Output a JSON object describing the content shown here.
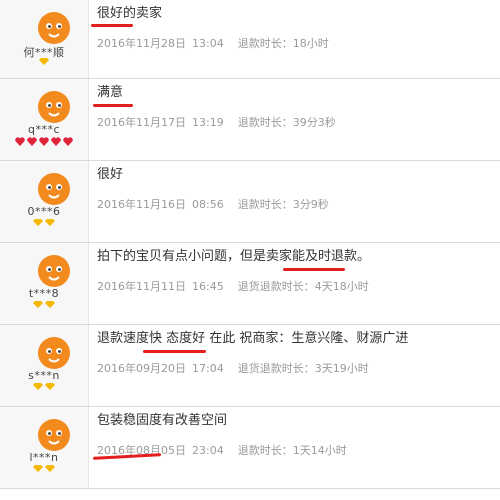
{
  "reviews": [
    {
      "comment": "很好的卖家",
      "date": "2016年11月28日",
      "time": "13:04",
      "refund_label": "退款时长：",
      "duration": "18小时",
      "user": "何***顺",
      "badge_type": "yellow-diamond",
      "badge_count": 1
    },
    {
      "comment": "满意",
      "date": "2016年11月17日",
      "time": "13:19",
      "refund_label": "退款时长：",
      "duration": "39分3秒",
      "user": "q***c",
      "badge_type": "red-heart",
      "badge_count": 5
    },
    {
      "comment": "很好",
      "date": "2016年11月16日",
      "time": "08:56",
      "refund_label": "退款时长：",
      "duration": "3分9秒",
      "user": "0***6",
      "badge_type": "yellow-diamond",
      "badge_count": 2
    },
    {
      "comment": "拍下的宝贝有点小问题，但是卖家能及时退款。",
      "date": "2016年11月11日",
      "time": "16:45",
      "refund_label": "退货退款时长：",
      "duration": "4天18小时",
      "user": "t***8",
      "badge_type": "yellow-diamond",
      "badge_count": 2
    },
    {
      "comment": "退款速度快 态度好 在此 祝商家：生意兴隆、财源广进",
      "date": "2016年09月20日",
      "time": "17:04",
      "refund_label": "退货退款时长：",
      "duration": "3天19小时",
      "user": "s***n",
      "badge_type": "yellow-diamond",
      "badge_count": 2
    },
    {
      "comment": "包装稳固度有改善空间",
      "date": "2016年08月05日",
      "time": "23:04",
      "refund_label": "退款时长：",
      "duration": "1天14小时",
      "user": "l***n",
      "badge_type": "yellow-diamond",
      "badge_count": 2
    }
  ],
  "colors": {
    "underline": "#e41d1d",
    "meta_text": "#9a9a9a",
    "avatar": "#f28a1e",
    "diamond": "#f5b800",
    "heart": "#e0223a"
  },
  "icons": {
    "avatar": "orange-taobao-mascot-avatar-icon",
    "yellow_badge": "yellow-diamond-icon",
    "red_badge": "red-heart-icon"
  }
}
